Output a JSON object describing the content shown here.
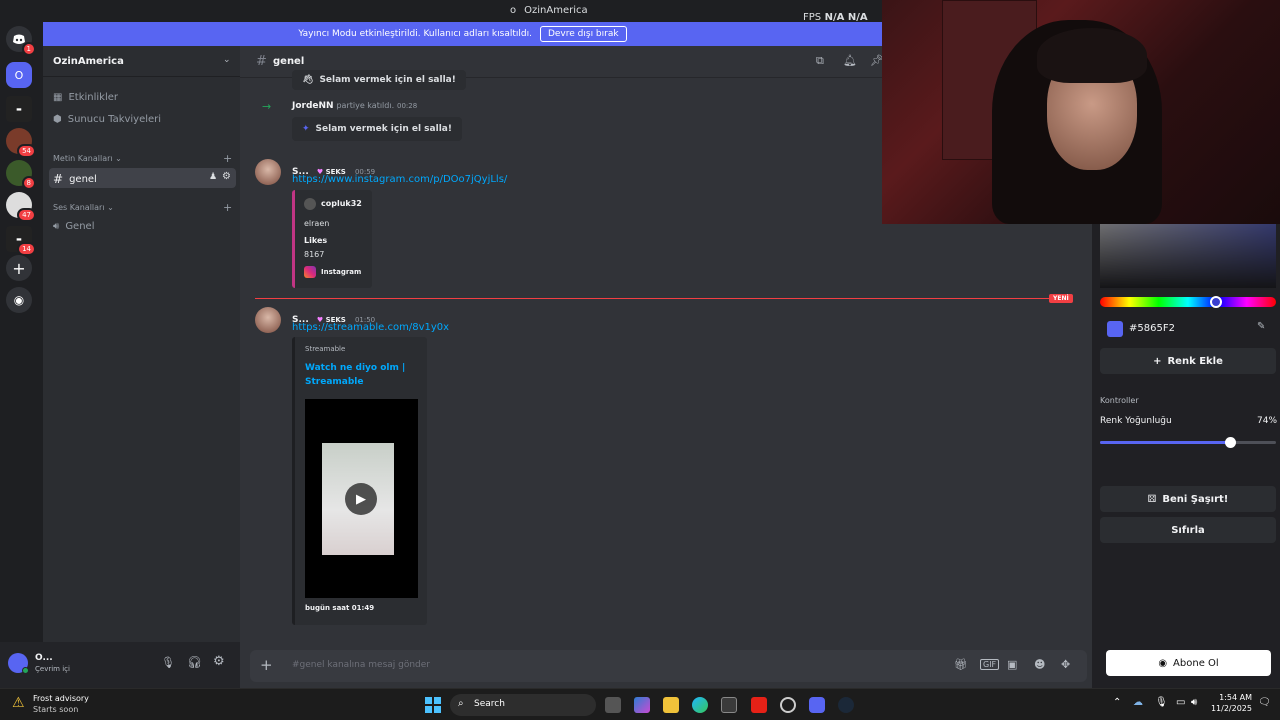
{
  "titlebar": {
    "title": "OzinAmerica",
    "fps_label": "FPS",
    "fps_value": "N/A",
    "fps_value2": "N/A"
  },
  "banner": {
    "text": "Yayıncı Modu etkinleştirildi. Kullanıcı adları kısaltıldı.",
    "button": "Devre dışı bırak"
  },
  "rail": {
    "home_badge": "1",
    "server_initial": "O",
    "badges": [
      "54",
      "8",
      "47",
      "14"
    ]
  },
  "sidebar": {
    "server_name": "OzinAmerica",
    "items": [
      {
        "label": "Etkinlikler",
        "icon": "calendar-icon"
      },
      {
        "label": "Sunucu Takviyeleri",
        "icon": "boost-icon"
      }
    ],
    "text_category": "Metin Kanalları",
    "text_channel": "genel",
    "voice_category": "Ses Kanalları",
    "voice_channel": "Genel"
  },
  "user": {
    "name": "O...",
    "status": "Çevrim içi"
  },
  "chat": {
    "channel": "genel",
    "wave_top": "Selam vermek için el salla!",
    "join_user": "JordeNN",
    "join_text": "partiye katıldı.",
    "join_time": "00:28",
    "wave_label": "Selam vermek için el salla!",
    "msg1": {
      "author": "S...",
      "tag": "SEKS",
      "time": "00:59",
      "link": "https://www.instagram.com/p/DOo7jQyjLls/",
      "embed_author": "copluk32",
      "embed_desc": "elraen",
      "embed_field": "Likes",
      "embed_value": "8167",
      "embed_footer": "Instagram"
    },
    "new_label": "YENİ",
    "msg2": {
      "author": "S...",
      "tag": "SEKS",
      "time": "01:50",
      "link": "https://streamable.com/8v1y0x",
      "provider": "Streamable",
      "title": "Watch ne diyo olm | Streamable",
      "footer": "bugün saat 01:49"
    },
    "input_placeholder": "#genel kanalına mesaj gönder"
  },
  "panel": {
    "hex": "#5865F2",
    "swatch": "#5865F2",
    "add_color": "Renk Ekle",
    "controls": "Kontroller",
    "intensity_label": "Renk Yoğunluğu",
    "intensity_value": "74%",
    "intensity_fraction": 0.74,
    "surprise": "Beni Şaşırt!",
    "reset": "Sıfırla",
    "subscribe": "Abone Ol"
  },
  "taskbar": {
    "weather_title": "Frost advisory",
    "weather_sub": "Starts soon",
    "search": "Search",
    "time": "1:54 AM",
    "date": "11/2/2025"
  }
}
